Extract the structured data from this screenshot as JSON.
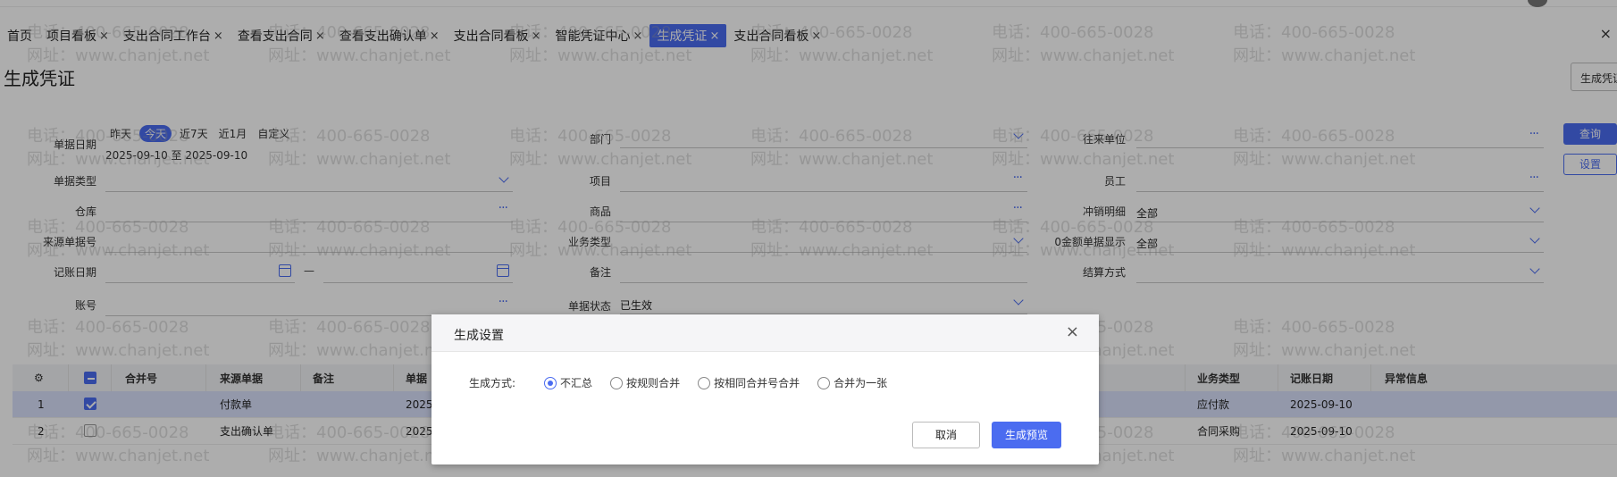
{
  "tabs": [
    {
      "label": "首页",
      "closable": false,
      "active": false
    },
    {
      "label": "项目看板",
      "closable": true,
      "active": false
    },
    {
      "label": "支出合同工作台",
      "closable": true,
      "active": false
    },
    {
      "label": "查看支出合同",
      "closable": true,
      "active": false
    },
    {
      "label": "查看支出确认单",
      "closable": true,
      "active": false
    },
    {
      "label": "支出合同看板",
      "closable": true,
      "active": false
    },
    {
      "label": "智能凭证中心",
      "closable": true,
      "active": false
    },
    {
      "label": "生成凭证",
      "closable": true,
      "active": true
    },
    {
      "label": "支出合同看板",
      "closable": true,
      "active": false
    }
  ],
  "close_glyph": "×",
  "page": {
    "title": "生成凭证",
    "generate_button": "生成凭证"
  },
  "filters": {
    "doc_date": {
      "label": "单据日期",
      "quick": [
        "昨天",
        "今天",
        "近7天",
        "近1月",
        "自定义"
      ],
      "quick_active": "今天",
      "range": "2025-09-10 至 2025-09-10"
    },
    "doc_type": {
      "label": "单据类型",
      "value": ""
    },
    "warehouse": {
      "label": "仓库",
      "value": ""
    },
    "source_no": {
      "label": "来源单据号",
      "value": ""
    },
    "post_date": {
      "label": "记账日期",
      "value": "",
      "sep": "—"
    },
    "account_no": {
      "label": "账号",
      "value": ""
    },
    "department": {
      "label": "部门",
      "value": ""
    },
    "project": {
      "label": "项目",
      "value": ""
    },
    "goods": {
      "label": "商品",
      "value": ""
    },
    "biz_type": {
      "label": "业务类型",
      "value": ""
    },
    "remark": {
      "label": "备注",
      "value": ""
    },
    "doc_status": {
      "label": "单据状态",
      "value": "已生效"
    },
    "partner": {
      "label": "往来单位",
      "value": ""
    },
    "employee": {
      "label": "员工",
      "value": ""
    },
    "offset_detail": {
      "label": "冲销明细",
      "value": "全部"
    },
    "zero_amount": {
      "label": "0金额单据显示",
      "value": "全部"
    },
    "settlement": {
      "label": "结算方式",
      "value": ""
    }
  },
  "buttons": {
    "query": "查询",
    "settings": "设置"
  },
  "table": {
    "columns": [
      "合并号",
      "来源单据",
      "备注",
      "单据",
      "业务类型",
      "记账日期",
      "异常信息"
    ],
    "rows": [
      {
        "index": "1",
        "checked": true,
        "source": "付款单",
        "doc": "2025",
        "biz_type": "应付款",
        "post_date": "2025-09-10"
      },
      {
        "index": "2",
        "checked": false,
        "source": "支出确认单",
        "doc": "2025",
        "biz_type": "合同采购",
        "post_date": "2025-09-10"
      }
    ]
  },
  "modal": {
    "title": "生成设置",
    "method_label": "生成方式:",
    "options": [
      "不汇总",
      "按规则合并",
      "按相同合并号合并",
      "合并为一张"
    ],
    "selected": "不汇总",
    "cancel": "取消",
    "preview": "生成预览"
  },
  "watermark": {
    "phone": "电话：400-665-0028",
    "site": "网址：www.chanjet.net"
  },
  "colors": {
    "accent": "#4b6cf0",
    "overlay": "rgba(0,0,0,0.32)",
    "selected_row": "#d9e0fb"
  }
}
